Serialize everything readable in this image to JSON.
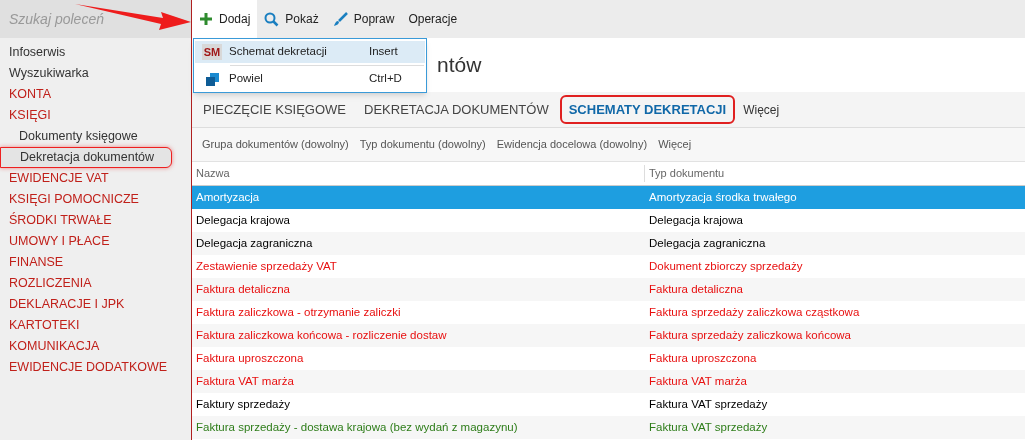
{
  "search": {
    "placeholder": "Szukaj poleceń"
  },
  "toolbar": [
    {
      "kind": "plus",
      "label": "Dodaj",
      "selected": true
    },
    {
      "kind": "search",
      "label": "Pokaż",
      "selected": false
    },
    {
      "kind": "brush",
      "label": "Popraw",
      "selected": false
    },
    {
      "kind": "none",
      "label": "Operacje",
      "selected": false
    }
  ],
  "dropdown": [
    {
      "kind": "badge",
      "badge": "SM",
      "label": "Schemat dekretacji",
      "shortcut": "Insert",
      "selected": true
    },
    {
      "kind": "copy",
      "label": "Powiel",
      "shortcut": "Ctrl+D",
      "selected": false
    }
  ],
  "sidebar": {
    "items": [
      {
        "label": "Infoserwis",
        "kind": "link",
        "selected": false
      },
      {
        "label": "Wyszukiwarka",
        "kind": "link",
        "selected": false
      },
      {
        "label": "KONTA",
        "kind": "section",
        "selected": false
      },
      {
        "label": "KSIĘGI",
        "kind": "section",
        "selected": false,
        "children": [
          {
            "label": "Dokumenty księgowe",
            "kind": "link",
            "selected": false
          },
          {
            "label": "Dekretacja dokumentów",
            "kind": "link",
            "selected": true
          }
        ]
      },
      {
        "label": "EWIDENCJE VAT",
        "kind": "section",
        "selected": false
      },
      {
        "label": "KSIĘGI POMOCNICZE",
        "kind": "section",
        "selected": false
      },
      {
        "label": "ŚRODKI TRWAŁE",
        "kind": "section",
        "selected": false
      },
      {
        "label": "UMOWY I PŁACE",
        "kind": "section",
        "selected": false
      },
      {
        "label": "FINANSE",
        "kind": "section",
        "selected": false
      },
      {
        "label": "ROZLICZENIA",
        "kind": "section",
        "selected": false
      },
      {
        "label": "DEKLARACJE I JPK",
        "kind": "section",
        "selected": false
      },
      {
        "label": "KARTOTEKI",
        "kind": "section",
        "selected": false
      },
      {
        "label": "KOMUNIKACJA",
        "kind": "section",
        "selected": false
      },
      {
        "label": "EWIDENCJE DODATKOWE",
        "kind": "section",
        "selected": false
      }
    ]
  },
  "page_title": "ntów",
  "tabs": [
    {
      "label": "PIECZĘCIE KSIĘGOWE",
      "selected": false
    },
    {
      "label": "DEKRETACJA DOKUMENTÓW",
      "selected": false
    },
    {
      "label": "SCHEMATY DEKRETACJI",
      "selected": true
    }
  ],
  "tabs_more": "Więcej",
  "filters": [
    "Grupa dokumentów (dowolny)",
    "Typ dokumentu (dowolny)",
    "Ewidencja docelowa (dowolny)"
  ],
  "filters_more": "Więcej",
  "table": {
    "columns": [
      "Nazwa",
      "Typ dokumentu"
    ],
    "rows": [
      {
        "cells": [
          "Amortyzacja",
          "Amortyzacja środka trwałego"
        ],
        "color": "#ffffff",
        "selected": true
      },
      {
        "cells": [
          "Delegacja krajowa",
          "Delegacja krajowa"
        ],
        "color": "#000000",
        "selected": false
      },
      {
        "cells": [
          "Delegacja zagraniczna",
          "Delegacja zagraniczna"
        ],
        "color": "#000000",
        "selected": false
      },
      {
        "cells": [
          "Zestawienie sprzedaży VAT",
          "Dokument zbiorczy sprzedaży"
        ],
        "color": "#e81010",
        "selected": false
      },
      {
        "cells": [
          "Faktura detaliczna",
          "Faktura detaliczna"
        ],
        "color": "#e81010",
        "selected": false
      },
      {
        "cells": [
          "Faktura zaliczkowa - otrzymanie zaliczki",
          "Faktura sprzedaży zaliczkowa cząstkowa"
        ],
        "color": "#e81010",
        "selected": false
      },
      {
        "cells": [
          "Faktura zaliczkowa końcowa - rozliczenie dostaw",
          "Faktura sprzedaży zaliczkowa końcowa"
        ],
        "color": "#e81010",
        "selected": false
      },
      {
        "cells": [
          "Faktura uproszczona",
          "Faktura uproszczona"
        ],
        "color": "#e81010",
        "selected": false
      },
      {
        "cells": [
          "Faktura VAT marża",
          "Faktura VAT marża"
        ],
        "color": "#e81010",
        "selected": false
      },
      {
        "cells": [
          "Faktury sprzedaży",
          "Faktura VAT sprzedaży"
        ],
        "color": "#000000",
        "selected": false
      },
      {
        "cells": [
          "Faktura sprzedaży - dostawa krajowa (bez wydań z magazynu)",
          "Faktura VAT sprzedaży"
        ],
        "color": "#2e7d1a",
        "selected": false
      }
    ]
  }
}
